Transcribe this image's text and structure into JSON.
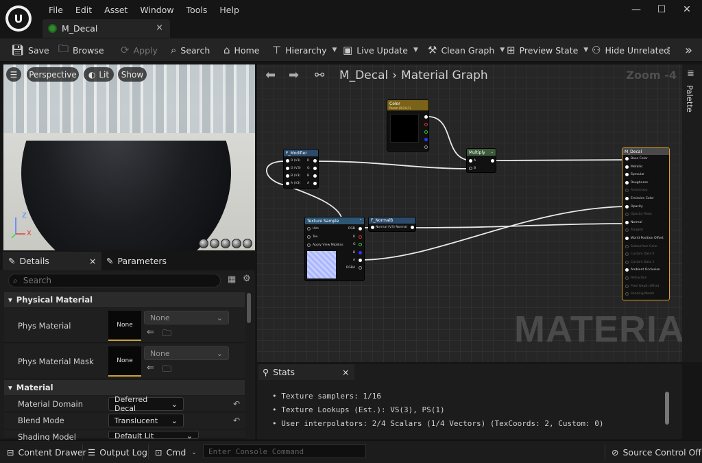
{
  "menu": [
    "File",
    "Edit",
    "Asset",
    "Window",
    "Tools",
    "Help"
  ],
  "window_controls": {
    "minimize": "—",
    "maximize": "☐",
    "close": "✕"
  },
  "document_tab": {
    "label": "M_Decal",
    "close": "×"
  },
  "toolbar": {
    "save": "Save",
    "browse": "Browse",
    "apply": "Apply",
    "search": "Search",
    "home": "Home",
    "hierarchy": "Hierarchy",
    "live_update": "Live Update",
    "clean_graph": "Clean Graph",
    "preview_state": "Preview State",
    "hide_unrelated": "Hide Unrelated",
    "more": "⋮",
    "expand": "»"
  },
  "viewport": {
    "perspective": "Perspective",
    "lit": "Lit",
    "show": "Show",
    "axis_z": "Z",
    "axis_x": "X"
  },
  "details": {
    "tab_details": "Details",
    "tab_parameters": "Parameters",
    "close": "×",
    "search_placeholder": "Search",
    "category_physical": "Physical Material",
    "phys_material": "Phys Material",
    "phys_material_mask": "Phys Material Mask",
    "none": "None",
    "category_material": "Material",
    "material_domain": "Material Domain",
    "material_domain_value": "Deferred Decal",
    "blend_mode": "Blend Mode",
    "blend_mode_value": "Translucent",
    "shading_model": "Shading Model",
    "shading_model_value": "Default Lit"
  },
  "graph": {
    "breadcrumb_asset": "M_Decal",
    "breadcrumb_sep": "›",
    "breadcrumb_graph": "Material Graph",
    "zoom": "Zoom -4",
    "watermark": "MATERIAL",
    "palette": "Palette",
    "nodes": {
      "color": {
        "title": "Color",
        "subtitle": "Param (0,0,0,1)"
      },
      "modifier": {
        "title": "F_Modifier",
        "inputs": [
          "R (V3)",
          "G (V3)",
          "B (V3)",
          "A (V3)"
        ],
        "outputs": [
          "R",
          "G",
          "B",
          "A"
        ]
      },
      "multiply": {
        "title": "Multiply",
        "inputs": [
          "A",
          "B"
        ]
      },
      "texture": {
        "title": "Texture Sample",
        "inputs": [
          "UVs",
          "Tex",
          "Apply View MipBias"
        ],
        "outputs": [
          "RGB",
          "R",
          "G",
          "B",
          "A",
          "RGBA"
        ]
      },
      "normal": {
        "title": "F_NormalB",
        "row": "Normal (V3) Normal"
      },
      "result": {
        "title": "M_Decal",
        "pins": [
          "Base Color",
          "Metallic",
          "Specular",
          "Roughness",
          "Anisotropy",
          "Emissive Color",
          "Opacity",
          "Opacity Mask",
          "Normal",
          "Tangent",
          "World Position Offset",
          "Subsurface Color",
          "Custom Data 0",
          "Custom Data 1",
          "Ambient Occlusion",
          "Refraction",
          "Pixel Depth Offset",
          "Shading Model"
        ]
      }
    }
  },
  "stats": {
    "tab": "Stats",
    "close": "×",
    "lines": [
      "Texture samplers: 1/16",
      "Texture Lookups (Est.): VS(3), PS(1)",
      "User interpolators: 2/4 Scalars (1/4 Vectors) (TexCoords: 2, Custom: 0)"
    ]
  },
  "bottom": {
    "content_drawer": "Content Drawer",
    "output_log": "Output Log",
    "cmd": "Cmd",
    "console_placeholder": "Enter Console Command",
    "source_control": "Source Control Off"
  }
}
